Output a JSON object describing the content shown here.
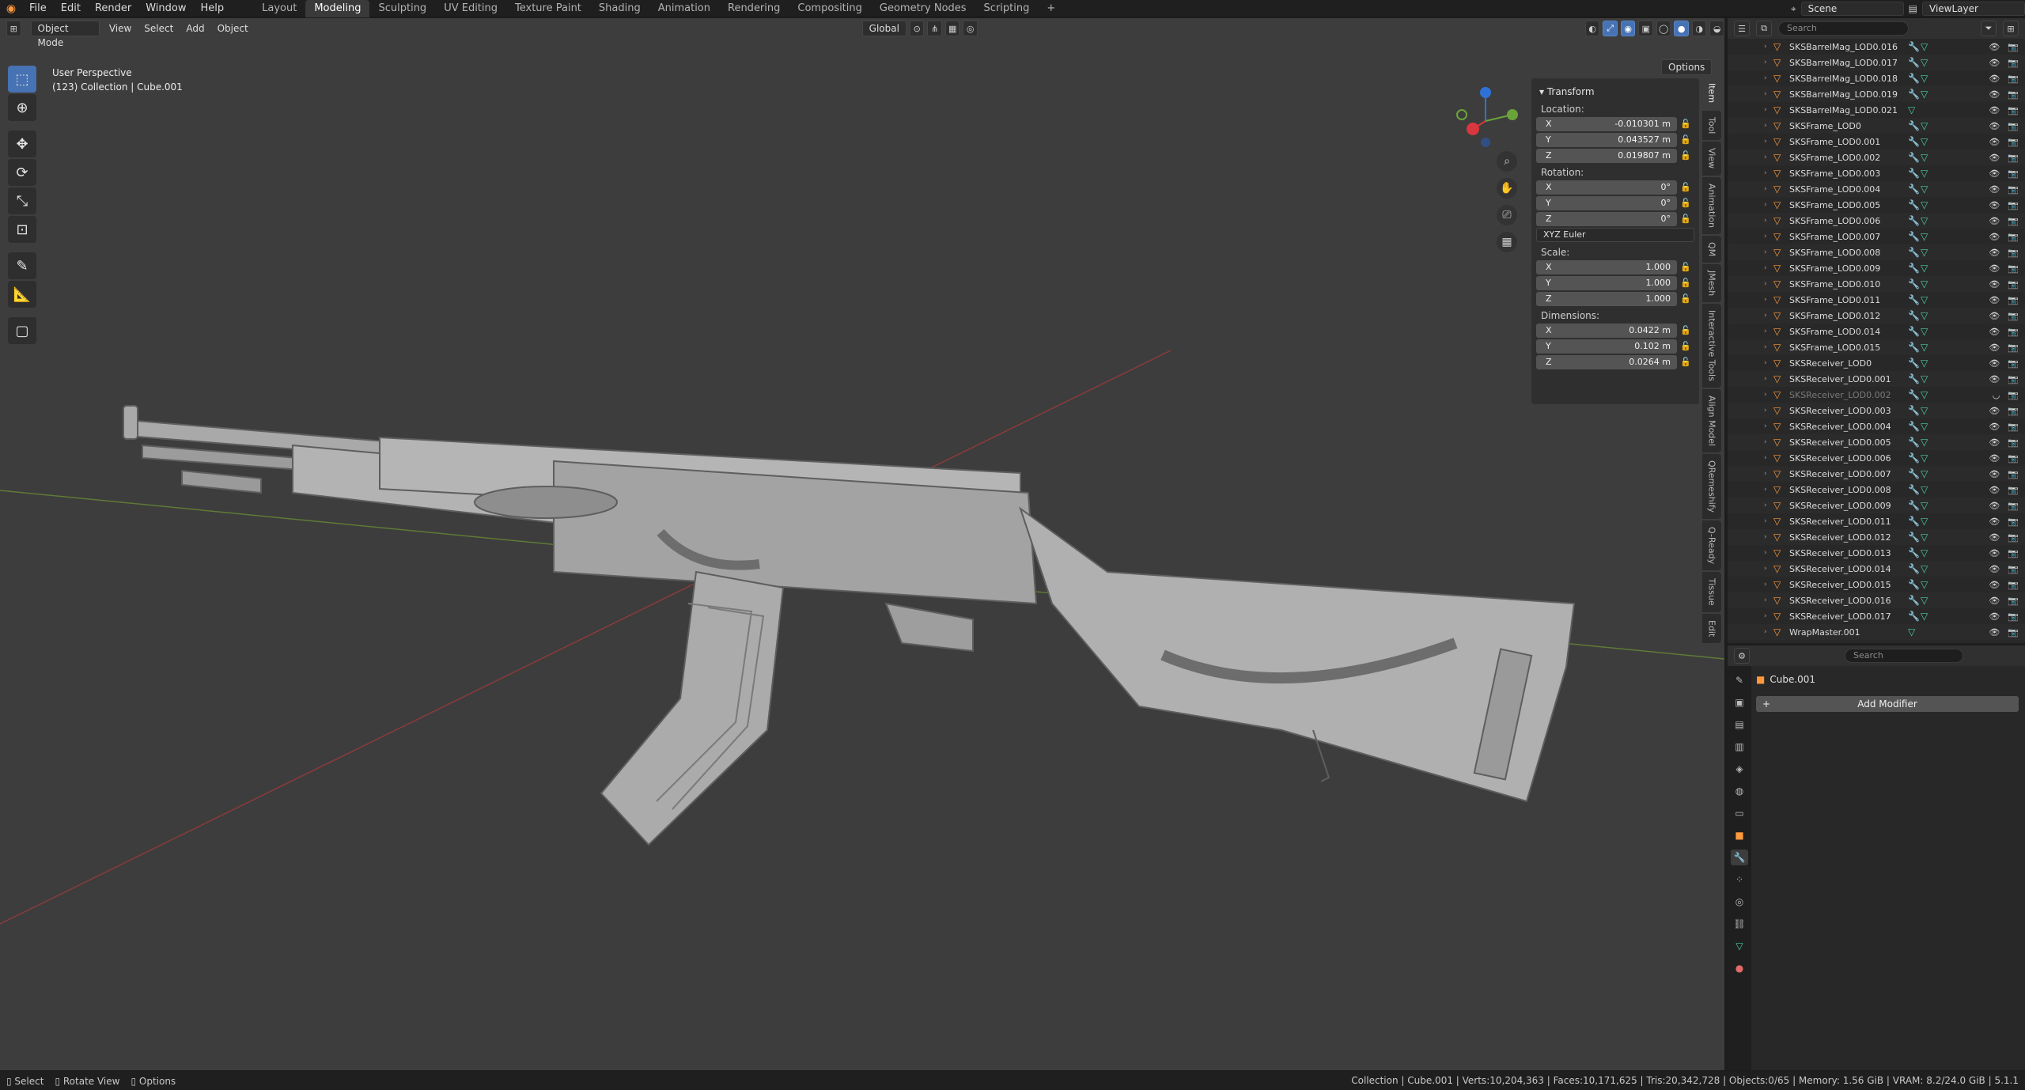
{
  "app": {
    "brand_color": "#ff9a3c"
  },
  "menus": [
    "File",
    "Edit",
    "Render",
    "Window",
    "Help"
  ],
  "workspaces": [
    {
      "label": "Layout",
      "active": false
    },
    {
      "label": "Modeling",
      "active": true
    },
    {
      "label": "Sculpting",
      "active": false
    },
    {
      "label": "UV Editing",
      "active": false
    },
    {
      "label": "Texture Paint",
      "active": false
    },
    {
      "label": "Shading",
      "active": false
    },
    {
      "label": "Animation",
      "active": false
    },
    {
      "label": "Rendering",
      "active": false
    },
    {
      "label": "Compositing",
      "active": false
    },
    {
      "label": "Geometry Nodes",
      "active": false
    },
    {
      "label": "Scripting",
      "active": false
    }
  ],
  "topright": {
    "scene": "Scene",
    "view_layer": "ViewLayer"
  },
  "viewport": {
    "mode": "Object Mode",
    "menus": [
      "View",
      "Select",
      "Add",
      "Object"
    ],
    "orientation": "Global",
    "overlay_line1": "User Perspective",
    "overlay_line2": "(123) Collection | Cube.001",
    "options": "Options"
  },
  "npanel": {
    "title": "Transform",
    "location_label": "Location:",
    "location": [
      {
        "axis": "X",
        "value": "-0.010301 m"
      },
      {
        "axis": "Y",
        "value": "0.043527 m"
      },
      {
        "axis": "Z",
        "value": "0.019807 m"
      }
    ],
    "rotation_label": "Rotation:",
    "rotation": [
      {
        "axis": "X",
        "value": "0°"
      },
      {
        "axis": "Y",
        "value": "0°"
      },
      {
        "axis": "Z",
        "value": "0°"
      }
    ],
    "rotation_mode": "XYZ Euler",
    "scale_label": "Scale:",
    "scale": [
      {
        "axis": "X",
        "value": "1.000"
      },
      {
        "axis": "Y",
        "value": "1.000"
      },
      {
        "axis": "Z",
        "value": "1.000"
      }
    ],
    "dimensions_label": "Dimensions:",
    "dimensions": [
      {
        "axis": "X",
        "value": "0.0422 m"
      },
      {
        "axis": "Y",
        "value": "0.102 m"
      },
      {
        "axis": "Z",
        "value": "0.0264 m"
      }
    ]
  },
  "sidebar_tabs": [
    "Item",
    "Tool",
    "View",
    "Animation",
    "QM",
    "JMesh",
    "Interactive Tools",
    "Align Model",
    "QRemeshify",
    "Q-Ready",
    "Tissue",
    "Edit"
  ],
  "outliner": {
    "search_placeholder": "Search",
    "rows": [
      {
        "name": "SKSBarrelMag_LOD0.016",
        "mod": true,
        "dim": false
      },
      {
        "name": "SKSBarrelMag_LOD0.017",
        "mod": true,
        "dim": false
      },
      {
        "name": "SKSBarrelMag_LOD0.018",
        "mod": true,
        "dim": false
      },
      {
        "name": "SKSBarrelMag_LOD0.019",
        "mod": true,
        "dim": false
      },
      {
        "name": "SKSBarrelMag_LOD0.021",
        "mod": false,
        "dim": false
      },
      {
        "name": "SKSFrame_LOD0",
        "mod": true,
        "dim": false
      },
      {
        "name": "SKSFrame_LOD0.001",
        "mod": true,
        "dim": false
      },
      {
        "name": "SKSFrame_LOD0.002",
        "mod": true,
        "dim": false
      },
      {
        "name": "SKSFrame_LOD0.003",
        "mod": true,
        "dim": false
      },
      {
        "name": "SKSFrame_LOD0.004",
        "mod": true,
        "dim": false
      },
      {
        "name": "SKSFrame_LOD0.005",
        "mod": true,
        "dim": false
      },
      {
        "name": "SKSFrame_LOD0.006",
        "mod": true,
        "dim": false
      },
      {
        "name": "SKSFrame_LOD0.007",
        "mod": true,
        "dim": false
      },
      {
        "name": "SKSFrame_LOD0.008",
        "mod": true,
        "dim": false
      },
      {
        "name": "SKSFrame_LOD0.009",
        "mod": true,
        "dim": false
      },
      {
        "name": "SKSFrame_LOD0.010",
        "mod": true,
        "dim": false
      },
      {
        "name": "SKSFrame_LOD0.011",
        "mod": true,
        "dim": false
      },
      {
        "name": "SKSFrame_LOD0.012",
        "mod": true,
        "dim": false
      },
      {
        "name": "SKSFrame_LOD0.014",
        "mod": true,
        "dim": false
      },
      {
        "name": "SKSFrame_LOD0.015",
        "mod": true,
        "dim": false
      },
      {
        "name": "SKSReceiver_LOD0",
        "mod": true,
        "dim": false
      },
      {
        "name": "SKSReceiver_LOD0.001",
        "mod": true,
        "dim": false
      },
      {
        "name": "SKSReceiver_LOD0.002",
        "mod": true,
        "dim": true
      },
      {
        "name": "SKSReceiver_LOD0.003",
        "mod": true,
        "dim": false
      },
      {
        "name": "SKSReceiver_LOD0.004",
        "mod": true,
        "dim": false
      },
      {
        "name": "SKSReceiver_LOD0.005",
        "mod": true,
        "dim": false
      },
      {
        "name": "SKSReceiver_LOD0.006",
        "mod": true,
        "dim": false
      },
      {
        "name": "SKSReceiver_LOD0.007",
        "mod": true,
        "dim": false
      },
      {
        "name": "SKSReceiver_LOD0.008",
        "mod": true,
        "dim": false
      },
      {
        "name": "SKSReceiver_LOD0.009",
        "mod": true,
        "dim": false
      },
      {
        "name": "SKSReceiver_LOD0.011",
        "mod": true,
        "dim": false
      },
      {
        "name": "SKSReceiver_LOD0.012",
        "mod": true,
        "dim": false
      },
      {
        "name": "SKSReceiver_LOD0.013",
        "mod": true,
        "dim": false
      },
      {
        "name": "SKSReceiver_LOD0.014",
        "mod": true,
        "dim": false
      },
      {
        "name": "SKSReceiver_LOD0.015",
        "mod": true,
        "dim": false
      },
      {
        "name": "SKSReceiver_LOD0.016",
        "mod": true,
        "dim": false
      },
      {
        "name": "SKSReceiver_LOD0.017",
        "mod": true,
        "dim": false
      },
      {
        "name": "WrapMaster.001",
        "mod": false,
        "dim": false
      }
    ]
  },
  "properties": {
    "search_placeholder": "Search",
    "object_name": "Cube.001",
    "add_modifier": "Add Modifier"
  },
  "statusbar": {
    "select": "Select",
    "rotate": "Rotate View",
    "options": "Options",
    "stats": "Collection | Cube.001 | Verts:10,204,363 | Faces:10,171,625 | Tris:20,342,728 | Objects:0/65 | Memory: 1.56 GiB | VRAM: 8.2/24.0 GiB | 5.1.1"
  }
}
